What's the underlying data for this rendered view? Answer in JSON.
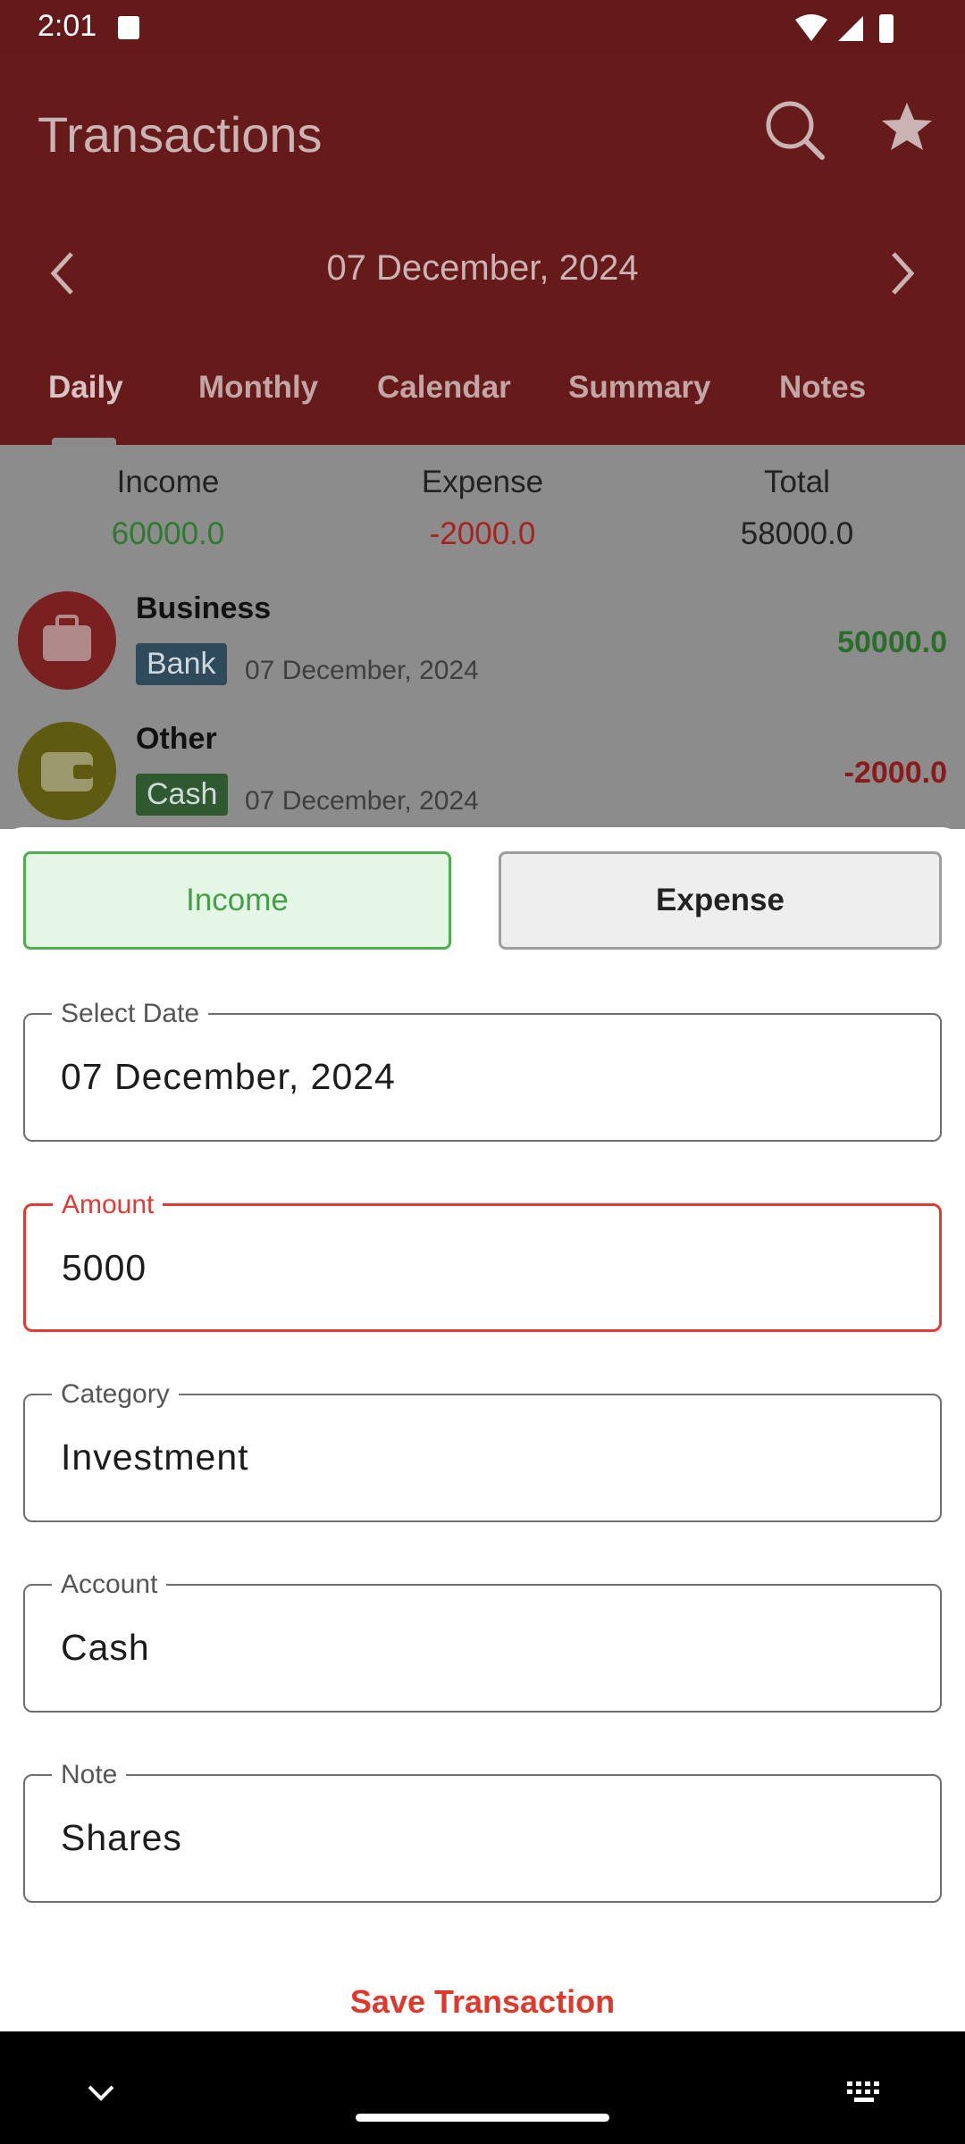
{
  "status_bar": {
    "time": "2:01"
  },
  "header": {
    "title": "Transactions",
    "date": "07 December, 2024",
    "tabs": [
      "Daily",
      "Monthly",
      "Calendar",
      "Summary",
      "Notes"
    ]
  },
  "summary": {
    "income_label": "Income",
    "income_value": "60000.0",
    "expense_label": "Expense",
    "expense_value": "-2000.0",
    "total_label": "Total",
    "total_value": "58000.0"
  },
  "transactions": [
    {
      "title": "Business",
      "account": "Bank",
      "date": "07 December, 2024",
      "amount": "50000.0",
      "icon": "briefcase-icon"
    },
    {
      "title": "Other",
      "account": "Cash",
      "date": "07 December, 2024",
      "amount": "-2000.0",
      "icon": "wallet-icon"
    }
  ],
  "form": {
    "income_toggle": "Income",
    "expense_toggle": "Expense",
    "date_label": "Select Date",
    "date_value": "07 December, 2024",
    "amount_label": "Amount",
    "amount_value": "5000",
    "category_label": "Category",
    "category_value": "Investment",
    "account_label": "Account",
    "account_value": "Cash",
    "note_label": "Note",
    "note_value": "Shares",
    "save_label": "Save Transaction"
  },
  "colors": {
    "header_bg": "#661a1a",
    "income_green": "#2e8b3a",
    "expense_red": "#c62828",
    "accent_red": "#e0392b"
  }
}
